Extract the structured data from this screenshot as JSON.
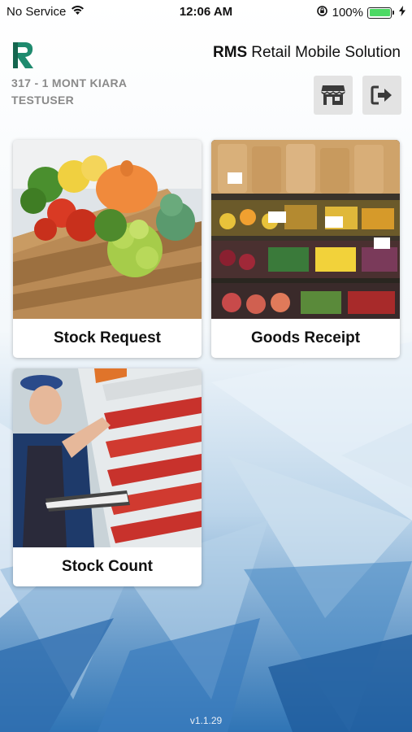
{
  "status_bar": {
    "carrier": "No Service",
    "time": "12:06 AM",
    "battery": "100%",
    "icons": [
      "wifi-icon",
      "rotation-lock-icon",
      "battery-icon",
      "charging-icon"
    ]
  },
  "header": {
    "app_abbr": "RMS",
    "app_title": "Retail Mobile Solution",
    "store": "317 - 1 MONT KIARA",
    "user": "TESTUSER",
    "buttons": [
      {
        "icon": "store-icon"
      },
      {
        "icon": "logout-icon"
      }
    ]
  },
  "menu": {
    "tiles": [
      {
        "label": "Stock Request",
        "image": "vegetable-crate-photo"
      },
      {
        "label": "Goods Receipt",
        "image": "fruit-market-photo"
      },
      {
        "label": "Stock Count",
        "image": "worker-shelves-photo"
      }
    ]
  },
  "footer": {
    "version": "v1.1.29"
  },
  "colors": {
    "accent": "#1f8a6e",
    "button_bg": "#e3e3e3",
    "secondary_text": "#8a8a8a",
    "background_blue": "#2a6fb3"
  }
}
